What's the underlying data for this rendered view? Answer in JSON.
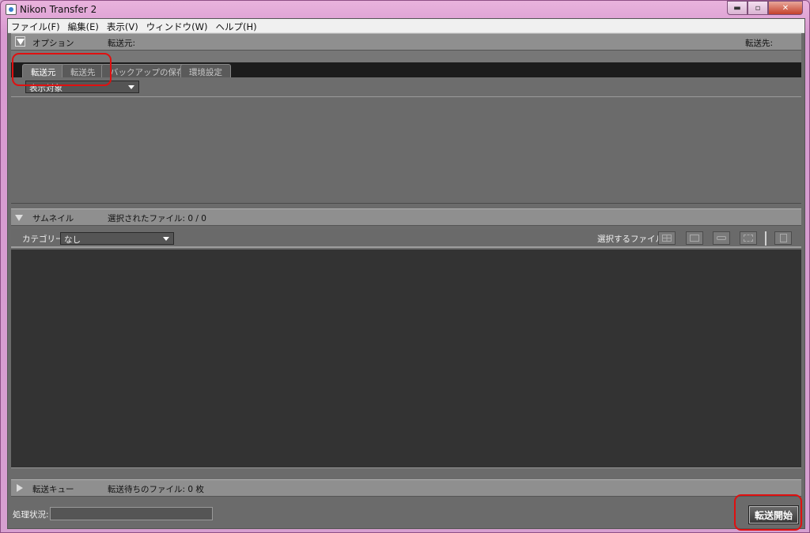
{
  "window": {
    "title": "Nikon Transfer 2",
    "controls": {
      "minimize": "▬",
      "maximize": "▫",
      "close": "✕"
    }
  },
  "menu": [
    "ファイル(F)",
    "編集(E)",
    "表示(V)",
    "ウィンドウ(W)",
    "ヘルプ(H)"
  ],
  "options": {
    "label": "オプション",
    "source_label": "転送元:",
    "dest_label": "転送先:",
    "tabs": [
      "転送元",
      "転送先",
      "バックアップの保存先",
      "環境設定"
    ],
    "active_tab": 0,
    "display_select": "表示対象"
  },
  "thumbnails": {
    "label": "サムネイル",
    "selected_files": "選択されたファイル: 0 / 0",
    "category_label": "カテゴリー:",
    "category_value": "なし",
    "select_files_label": "選択するファイル:",
    "icons": [
      "grid-icon",
      "wave-icon",
      "key-icon",
      "dashed-frame-icon",
      "trash-icon"
    ]
  },
  "queue": {
    "label": "転送キュー",
    "pending_files": "転送待ちのファイル: 0 枚"
  },
  "status": {
    "label": "処理状況:",
    "start_button": "転送開始"
  },
  "colors": {
    "highlight": "#e01010"
  }
}
